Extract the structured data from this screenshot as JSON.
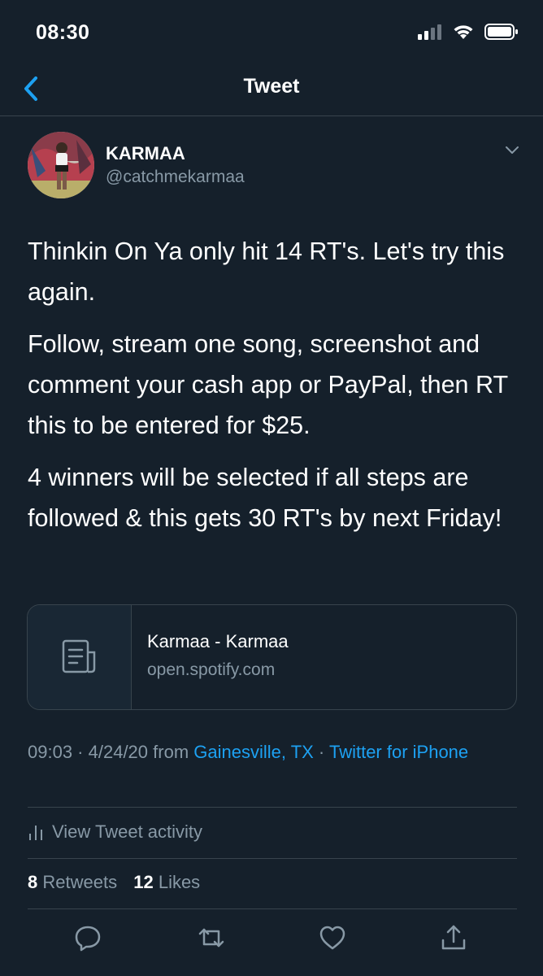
{
  "status_bar": {
    "time": "08:30"
  },
  "nav": {
    "title": "Tweet"
  },
  "tweet": {
    "author": {
      "display_name": "KARMAA",
      "handle": "@catchmekarmaa"
    },
    "paragraphs": [
      "Thinkin On Ya only hit 14 RT's. Let's try this again.",
      "Follow, stream one song, screenshot and comment your cash app or PayPal, then RT this to be entered for $25.",
      "4 winners will be selected if all steps are followed & this gets 30 RT's by next Friday!"
    ],
    "card": {
      "title": "Karmaa - Karmaa",
      "domain": "open.spotify.com"
    },
    "meta": {
      "time": "09:03",
      "sep1": " · ",
      "date": "4/24/20",
      "from": " from ",
      "location": "Gainesville, TX",
      "sep2": " · ",
      "source": "Twitter for iPhone"
    },
    "activity_label": "View Tweet activity",
    "stats": {
      "retweets_count": "8",
      "retweets_label": "Retweets",
      "likes_count": "12",
      "likes_label": "Likes"
    }
  },
  "colors": {
    "background": "#15202b",
    "accent": "#1da1f2",
    "secondary_text": "#8899a6",
    "border": "#38444d"
  },
  "icons": [
    "back-chevron-icon",
    "signal-icon",
    "wifi-icon",
    "battery-icon",
    "chevron-down-icon",
    "document-icon",
    "activity-bars-icon",
    "reply-icon",
    "retweet-icon",
    "like-icon",
    "share-icon"
  ]
}
